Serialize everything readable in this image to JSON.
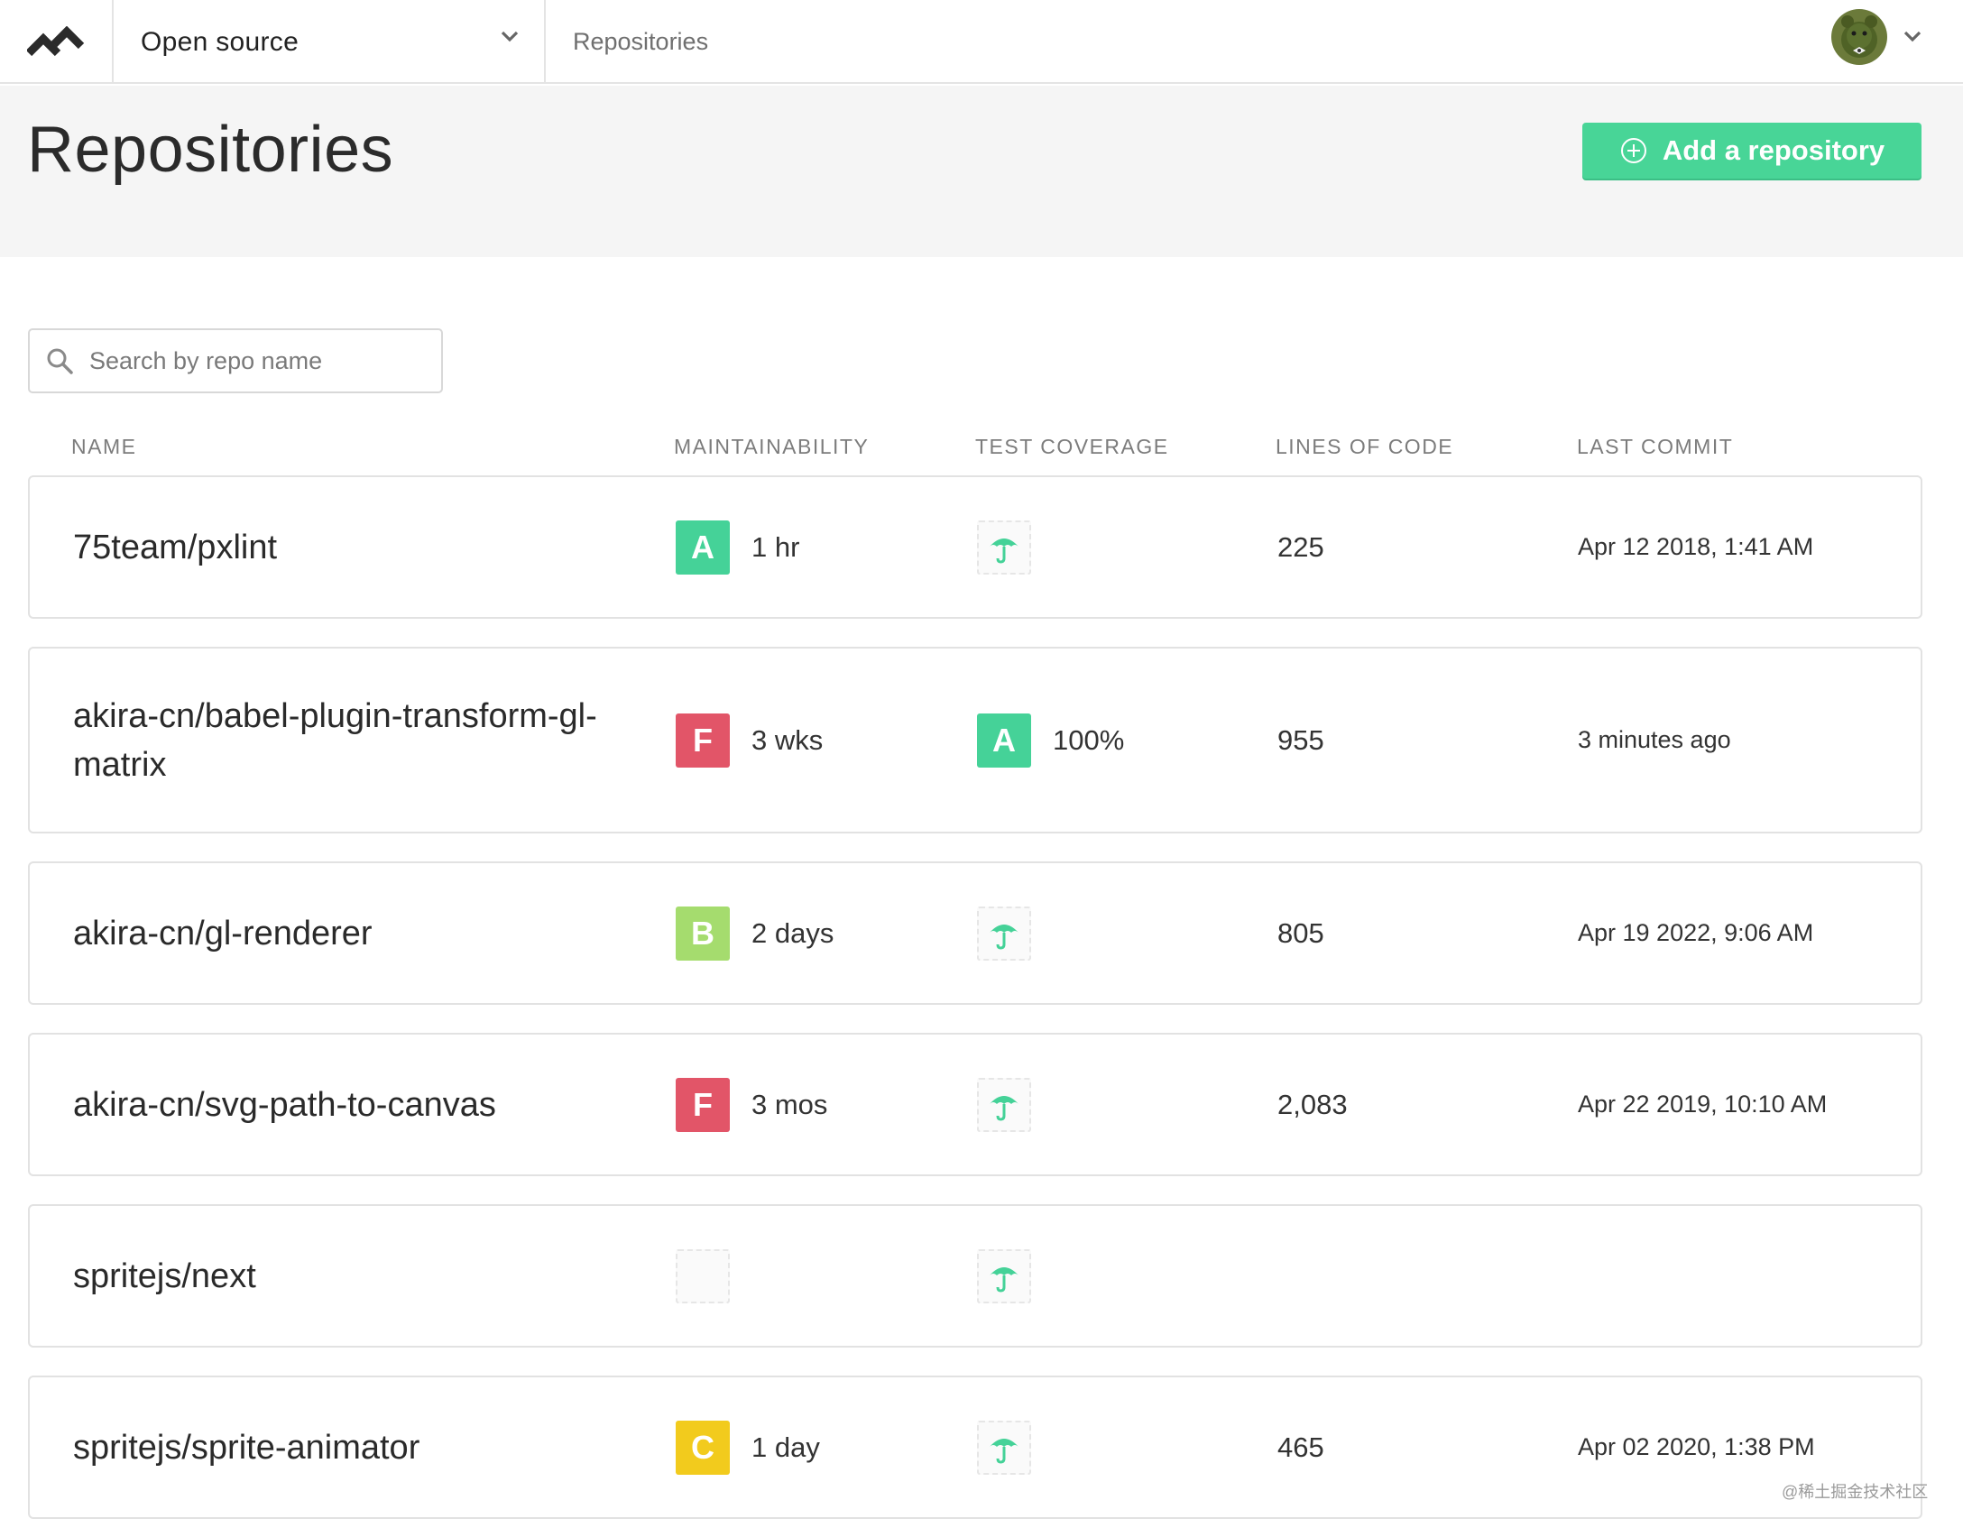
{
  "nav": {
    "org": "Open source",
    "breadcrumb": "Repositories"
  },
  "header": {
    "title": "Repositories",
    "add_button": "Add a repository"
  },
  "search": {
    "placeholder": "Search by repo name",
    "value": ""
  },
  "columns": [
    "NAME",
    "MAINTAINABILITY",
    "TEST COVERAGE",
    "LINES OF CODE",
    "LAST COMMIT"
  ],
  "grade_colors": {
    "A": "#45d298",
    "B": "#a5dc6e",
    "C": "#f2cb1d",
    "F": "#e25568"
  },
  "repos": [
    {
      "name": "75team/pxlint",
      "maintainability_grade": "A",
      "maintainability": "1 hr",
      "coverage_grade": "",
      "coverage": "",
      "lines_of_code": "225",
      "last_commit": "Apr 12 2018, 1:41 AM"
    },
    {
      "name": "akira-cn/babel-plugin-transform-gl-matrix",
      "maintainability_grade": "F",
      "maintainability": "3 wks",
      "coverage_grade": "A",
      "coverage": "100%",
      "lines_of_code": "955",
      "last_commit": "3 minutes ago"
    },
    {
      "name": "akira-cn/gl-renderer",
      "maintainability_grade": "B",
      "maintainability": "2 days",
      "coverage_grade": "",
      "coverage": "",
      "lines_of_code": "805",
      "last_commit": "Apr 19 2022, 9:06 AM"
    },
    {
      "name": "akira-cn/svg-path-to-canvas",
      "maintainability_grade": "F",
      "maintainability": "3 mos",
      "coverage_grade": "",
      "coverage": "",
      "lines_of_code": "2,083",
      "last_commit": "Apr 22 2019, 10:10 AM"
    },
    {
      "name": "spritejs/next",
      "maintainability_grade": "",
      "maintainability": "",
      "coverage_grade": "",
      "coverage": "",
      "lines_of_code": "",
      "last_commit": ""
    },
    {
      "name": "spritejs/sprite-animator",
      "maintainability_grade": "C",
      "maintainability": "1 day",
      "coverage_grade": "",
      "coverage": "",
      "lines_of_code": "465",
      "last_commit": "Apr 02 2020, 1:38 PM"
    }
  ],
  "watermark": "@稀土掘金技术社区"
}
